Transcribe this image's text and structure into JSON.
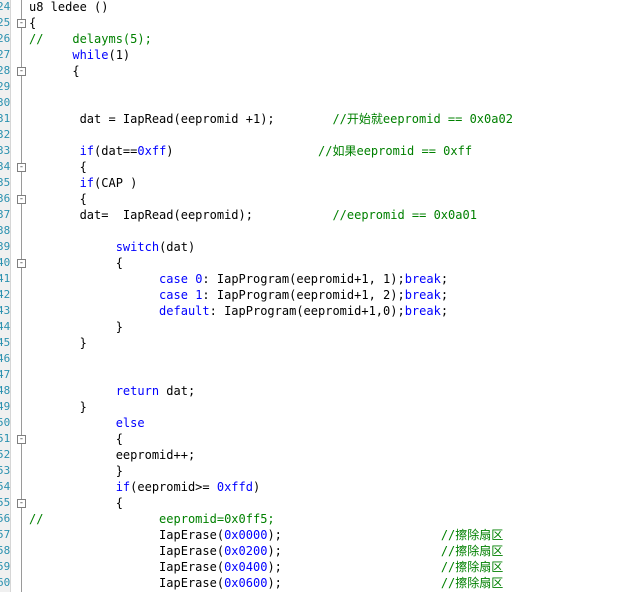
{
  "editor": {
    "lines": [
      {
        "no": "24",
        "fold": "",
        "seg": [
          [
            "tx",
            "u8 ledee ()"
          ]
        ]
      },
      {
        "no": "25",
        "fold": "-",
        "seg": [
          [
            "tx",
            "{"
          ]
        ]
      },
      {
        "no": "26",
        "fold": "",
        "seg": [
          [
            "cm",
            "//    delayms(5);"
          ]
        ]
      },
      {
        "no": "27",
        "fold": "",
        "seg": [
          [
            "tx",
            "      "
          ],
          [
            "kw",
            "while"
          ],
          [
            "tx",
            "(1)"
          ]
        ]
      },
      {
        "no": "28",
        "fold": "-",
        "seg": [
          [
            "tx",
            "      {"
          ]
        ]
      },
      {
        "no": "29",
        "fold": "",
        "seg": []
      },
      {
        "no": "30",
        "fold": "",
        "seg": []
      },
      {
        "no": "31",
        "fold": "",
        "seg": [
          [
            "tx",
            "       dat = IapRead(eepromid +1);        "
          ],
          [
            "cm",
            "//开始就eepromid == 0x0a02"
          ]
        ]
      },
      {
        "no": "32",
        "fold": "",
        "seg": []
      },
      {
        "no": "33",
        "fold": "",
        "seg": [
          [
            "tx",
            "       "
          ],
          [
            "kw",
            "if"
          ],
          [
            "tx",
            "(dat=="
          ],
          [
            "nm",
            "0xff"
          ],
          [
            "tx",
            ")                    "
          ],
          [
            "cm",
            "//如果eepromid == 0xff"
          ]
        ]
      },
      {
        "no": "34",
        "fold": "-",
        "seg": [
          [
            "tx",
            "       {"
          ]
        ]
      },
      {
        "no": "35",
        "fold": "",
        "seg": [
          [
            "tx",
            "       "
          ],
          [
            "kw",
            "if"
          ],
          [
            "tx",
            "(CAP )"
          ]
        ]
      },
      {
        "no": "36",
        "fold": "-",
        "seg": [
          [
            "tx",
            "       {"
          ]
        ]
      },
      {
        "no": "37",
        "fold": "",
        "seg": [
          [
            "tx",
            "       dat=  IapRead(eepromid);           "
          ],
          [
            "cm",
            "//eepromid == 0x0a01"
          ]
        ]
      },
      {
        "no": "38",
        "fold": "",
        "seg": []
      },
      {
        "no": "39",
        "fold": "",
        "seg": [
          [
            "tx",
            "            "
          ],
          [
            "kw",
            "switch"
          ],
          [
            "tx",
            "(dat)"
          ]
        ]
      },
      {
        "no": "40",
        "fold": "-",
        "seg": [
          [
            "tx",
            "            {"
          ]
        ]
      },
      {
        "no": "41",
        "fold": "",
        "seg": [
          [
            "tx",
            "                  "
          ],
          [
            "kw",
            "case"
          ],
          [
            "tx",
            " "
          ],
          [
            "nm",
            "0"
          ],
          [
            "tx",
            ": IapProgram(eepromid+1, 1);"
          ],
          [
            "kw",
            "break"
          ],
          [
            "tx",
            ";"
          ]
        ]
      },
      {
        "no": "42",
        "fold": "",
        "seg": [
          [
            "tx",
            "                  "
          ],
          [
            "kw",
            "case"
          ],
          [
            "tx",
            " "
          ],
          [
            "nm",
            "1"
          ],
          [
            "tx",
            ": IapProgram(eepromid+1, 2);"
          ],
          [
            "kw",
            "break"
          ],
          [
            "tx",
            ";"
          ]
        ]
      },
      {
        "no": "43",
        "fold": "",
        "seg": [
          [
            "tx",
            "                  "
          ],
          [
            "kw",
            "default"
          ],
          [
            "tx",
            ": IapProgram(eepromid+1,0);"
          ],
          [
            "kw",
            "break"
          ],
          [
            "tx",
            ";"
          ]
        ]
      },
      {
        "no": "44",
        "fold": "",
        "seg": [
          [
            "tx",
            "            }"
          ]
        ]
      },
      {
        "no": "45",
        "fold": "",
        "seg": [
          [
            "tx",
            "       }"
          ]
        ]
      },
      {
        "no": "46",
        "fold": "",
        "seg": []
      },
      {
        "no": "47",
        "fold": "",
        "seg": []
      },
      {
        "no": "48",
        "fold": "",
        "seg": [
          [
            "tx",
            "            "
          ],
          [
            "kw",
            "return"
          ],
          [
            "tx",
            " dat;"
          ]
        ]
      },
      {
        "no": "49",
        "fold": "",
        "seg": [
          [
            "tx",
            "       }"
          ]
        ]
      },
      {
        "no": "50",
        "fold": "",
        "seg": [
          [
            "tx",
            "            "
          ],
          [
            "kw",
            "else"
          ]
        ]
      },
      {
        "no": "51",
        "fold": "-",
        "seg": [
          [
            "tx",
            "            {"
          ]
        ]
      },
      {
        "no": "52",
        "fold": "",
        "seg": [
          [
            "tx",
            "            eepromid++;"
          ]
        ]
      },
      {
        "no": "53",
        "fold": "",
        "seg": [
          [
            "tx",
            "            }"
          ]
        ]
      },
      {
        "no": "54",
        "fold": "",
        "seg": [
          [
            "tx",
            "            "
          ],
          [
            "kw",
            "if"
          ],
          [
            "tx",
            "(eepromid>= "
          ],
          [
            "nm",
            "0xffd"
          ],
          [
            "tx",
            ")"
          ]
        ]
      },
      {
        "no": "55",
        "fold": "-",
        "seg": [
          [
            "tx",
            "            {"
          ]
        ]
      },
      {
        "no": "56",
        "fold": "",
        "seg": [
          [
            "cm",
            "//                eepromid=0x0ff5;"
          ]
        ]
      },
      {
        "no": "57",
        "fold": "",
        "seg": [
          [
            "tx",
            "                  IapErase("
          ],
          [
            "nm",
            "0x0000"
          ],
          [
            "tx",
            ");                      "
          ],
          [
            "cm",
            "//擦除扇区"
          ]
        ]
      },
      {
        "no": "58",
        "fold": "",
        "seg": [
          [
            "tx",
            "                  IapErase("
          ],
          [
            "nm",
            "0x0200"
          ],
          [
            "tx",
            ");                      "
          ],
          [
            "cm",
            "//擦除扇区"
          ]
        ]
      },
      {
        "no": "59",
        "fold": "",
        "seg": [
          [
            "tx",
            "                  IapErase("
          ],
          [
            "nm",
            "0x0400"
          ],
          [
            "tx",
            ");                      "
          ],
          [
            "cm",
            "//擦除扇区"
          ]
        ]
      },
      {
        "no": "60",
        "fold": "",
        "seg": [
          [
            "tx",
            "                  IapErase("
          ],
          [
            "nm",
            "0x0600"
          ],
          [
            "tx",
            ");                      "
          ],
          [
            "cm",
            "//擦除扇区"
          ]
        ]
      }
    ]
  }
}
